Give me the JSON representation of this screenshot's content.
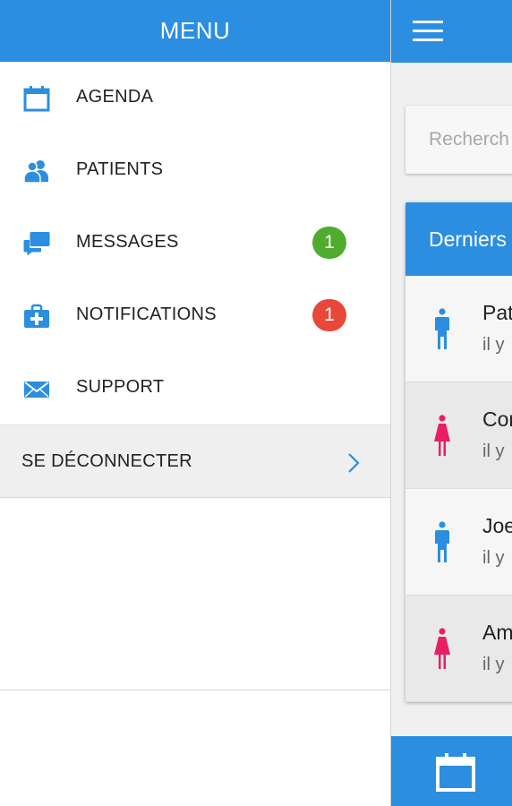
{
  "colors": {
    "primary": "#2b8ee0",
    "badge_green": "#4fac2f",
    "badge_red": "#e8473a",
    "male": "#2b8ee0",
    "female": "#e91e63"
  },
  "drawer": {
    "title": "MENU",
    "items": [
      {
        "label": "AGENDA",
        "icon": "calendar-icon"
      },
      {
        "label": "PATIENTS",
        "icon": "users-icon"
      },
      {
        "label": "MESSAGES",
        "icon": "chat-icon",
        "badge": "1"
      },
      {
        "label": "NOTIFICATIONS",
        "icon": "medical-kit-icon",
        "badge": "1"
      },
      {
        "label": "SUPPORT",
        "icon": "mail-icon"
      }
    ],
    "logout": {
      "label": "SE DÉCONNECTER",
      "icon": "chevron-right-icon"
    }
  },
  "main": {
    "menu_icon": "hamburger-icon",
    "search": {
      "placeholder": "Recherch"
    },
    "recent": {
      "title": "Derniers",
      "patients": [
        {
          "name": "Pat",
          "time": "il y",
          "gender": "male"
        },
        {
          "name": "Cor",
          "time": "il y",
          "gender": "female"
        },
        {
          "name": "Joe",
          "time": "il y",
          "gender": "male"
        },
        {
          "name": "Am",
          "time": "il y",
          "gender": "female"
        }
      ]
    },
    "bottom_icon": "calendar-icon"
  }
}
